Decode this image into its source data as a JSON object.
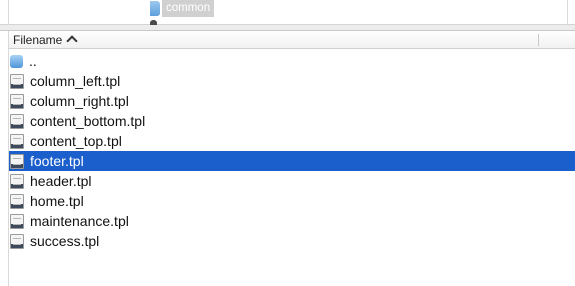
{
  "tree": {
    "visible_node_label": "common"
  },
  "list": {
    "header": {
      "filename_label": "Filename"
    },
    "rows": [
      {
        "name": "..",
        "icon": "folder-up-icon",
        "selected": false
      },
      {
        "name": "column_left.tpl",
        "icon": "file-icon",
        "selected": false
      },
      {
        "name": "column_right.tpl",
        "icon": "file-icon",
        "selected": false
      },
      {
        "name": "content_bottom.tpl",
        "icon": "file-icon",
        "selected": false
      },
      {
        "name": "content_top.tpl",
        "icon": "file-icon",
        "selected": false
      },
      {
        "name": "footer.tpl",
        "icon": "file-icon",
        "selected": true
      },
      {
        "name": "header.tpl",
        "icon": "file-icon",
        "selected": false
      },
      {
        "name": "home.tpl",
        "icon": "file-icon",
        "selected": false
      },
      {
        "name": "maintenance.tpl",
        "icon": "file-icon",
        "selected": false
      },
      {
        "name": "success.tpl",
        "icon": "file-icon",
        "selected": false
      }
    ]
  },
  "colors": {
    "selection": "#1a5fcc",
    "folder": "#5c9fdc"
  }
}
